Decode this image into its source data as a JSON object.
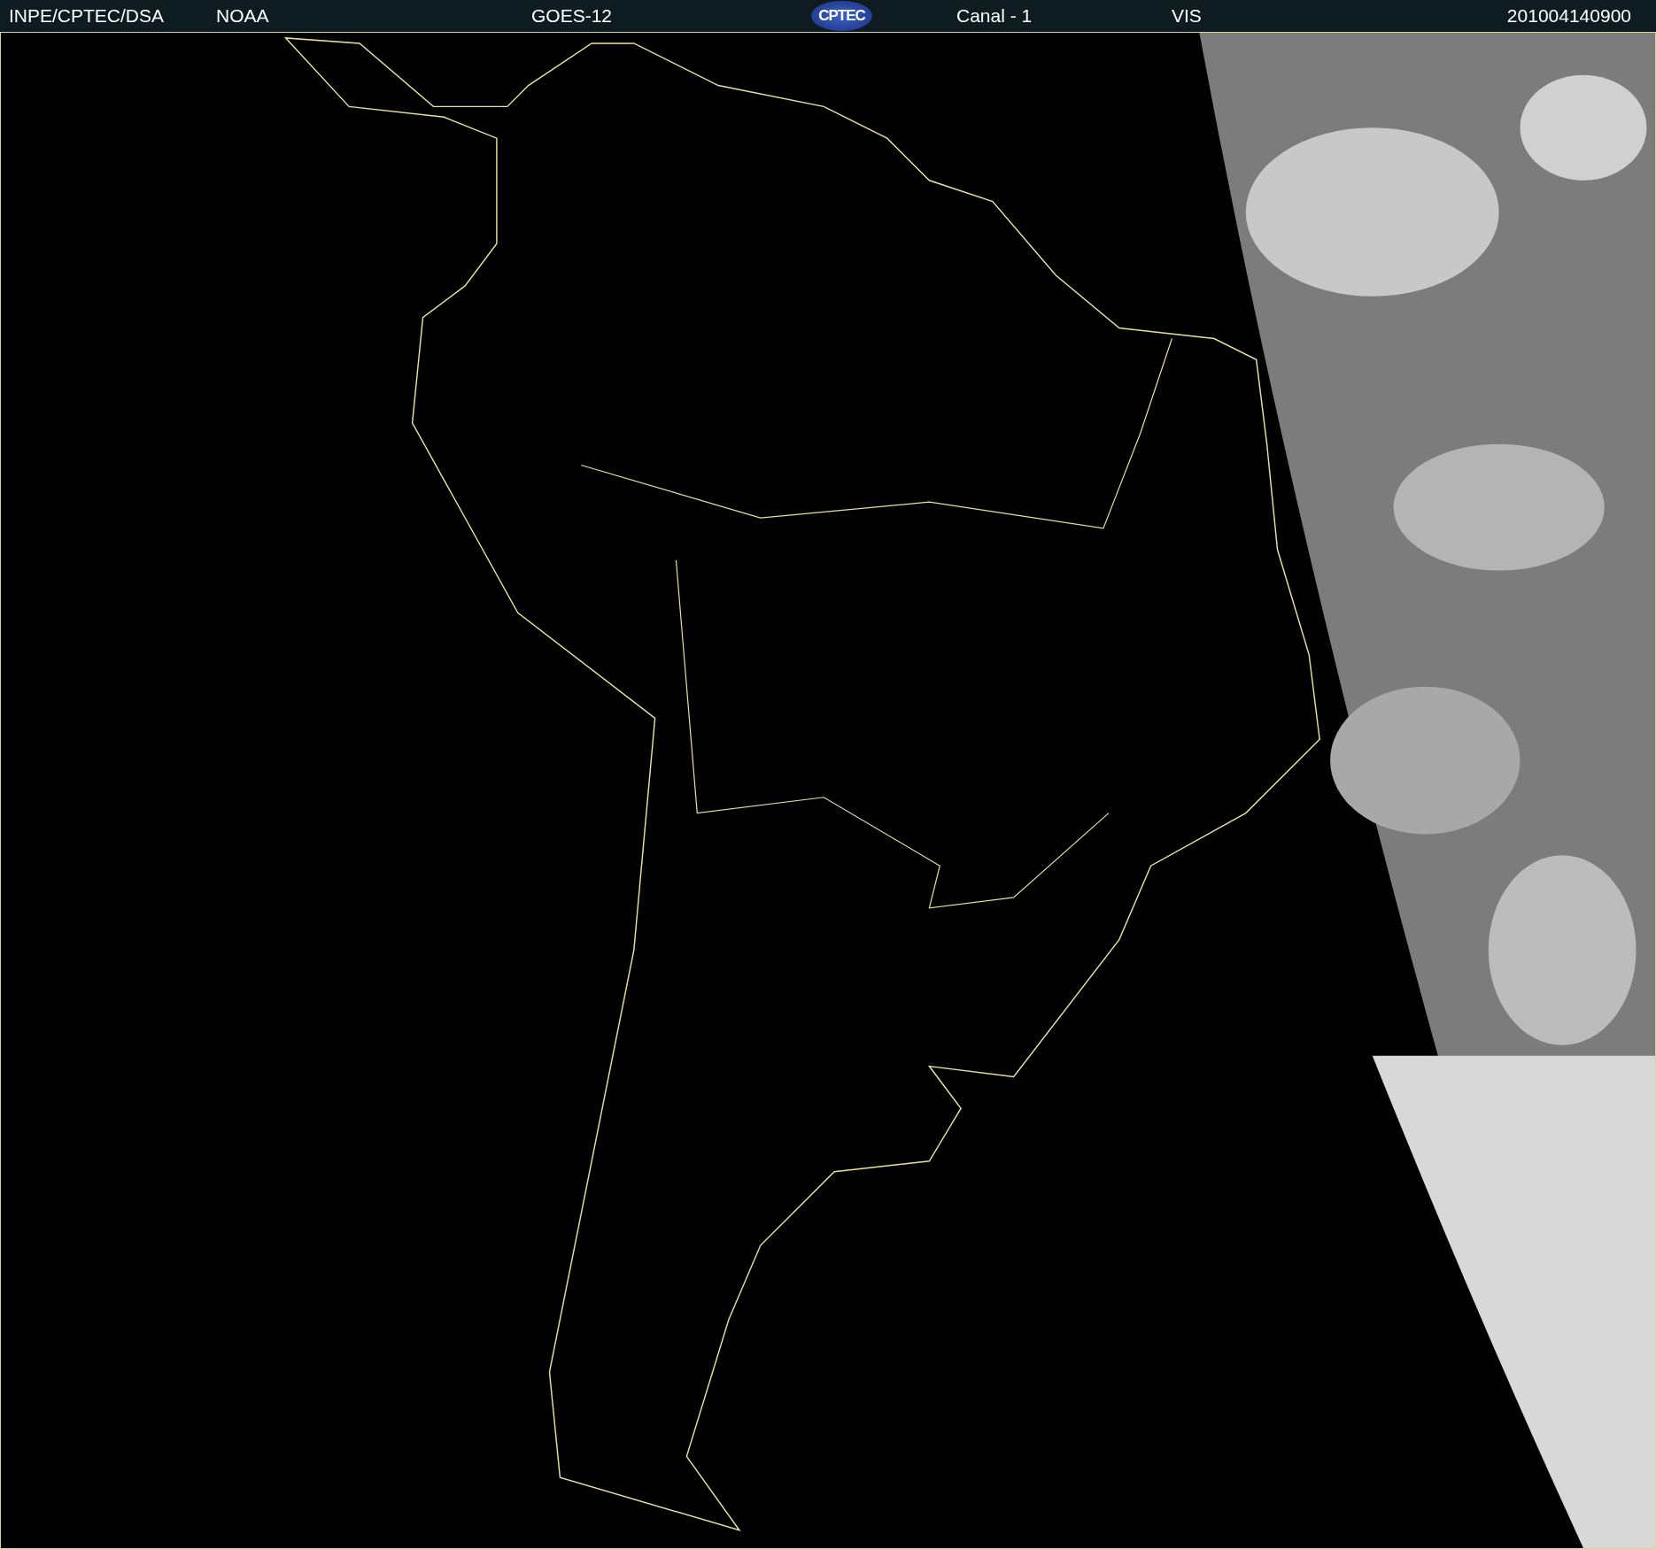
{
  "header": {
    "labels": [
      "INPE/CPTEC/DSA",
      "NOAA",
      "GOES-12"
    ],
    "logo": "CPTEC",
    "channel_labels": [
      "Canal - 1",
      "VIS"
    ],
    "timestamp": "201004140900"
  }
}
